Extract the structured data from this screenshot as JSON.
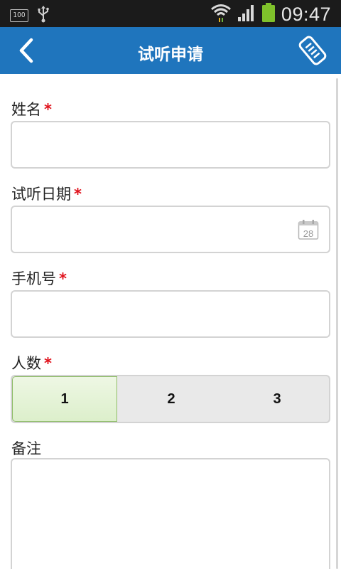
{
  "status_bar": {
    "battery_indicator": "100",
    "time": "09:47",
    "battery_color": "#7fc12b"
  },
  "action_bar": {
    "title": "试听申请",
    "background": "#1f75bd"
  },
  "form": {
    "name": {
      "label": "姓名",
      "required_mark": "*",
      "value": ""
    },
    "date": {
      "label": "试听日期",
      "required_mark": "*",
      "value": "",
      "calendar_day": "28"
    },
    "phone": {
      "label": "手机号",
      "required_mark": "*",
      "value": ""
    },
    "count": {
      "label": "人数",
      "required_mark": "*",
      "options": [
        "1",
        "2",
        "3"
      ],
      "selected": "1"
    },
    "remarks": {
      "label": "备注",
      "value": ""
    }
  }
}
